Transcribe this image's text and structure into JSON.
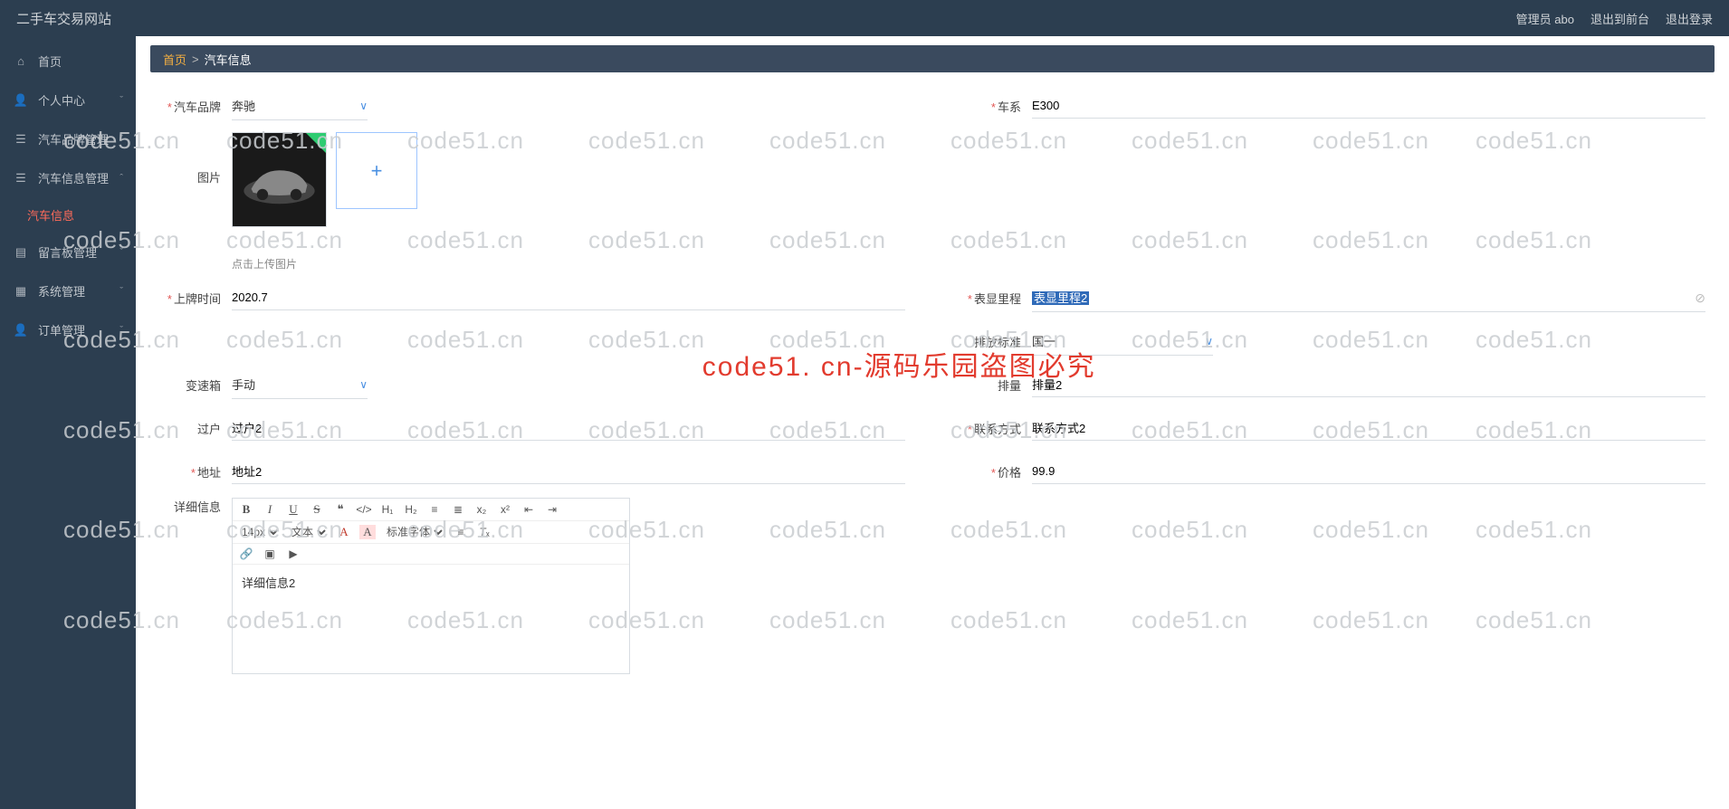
{
  "topbar": {
    "brand": "二手车交易网站",
    "user_label": "管理员 abo",
    "back_front": "退出到前台",
    "logout": "退出登录"
  },
  "sidebar": {
    "items": [
      {
        "icon": "home",
        "label": "首页",
        "chev": ""
      },
      {
        "icon": "user",
        "label": "个人中心",
        "chev": "›"
      },
      {
        "icon": "list",
        "label": "汽车品牌管理",
        "chev": "›"
      },
      {
        "icon": "list",
        "label": "汽车信息管理",
        "chev": "ˆ",
        "open": true,
        "sub": [
          {
            "label": "汽车信息"
          }
        ]
      },
      {
        "icon": "note",
        "label": "留言板管理",
        "chev": "›"
      },
      {
        "icon": "grid",
        "label": "系统管理",
        "chev": "›"
      },
      {
        "icon": "user",
        "label": "订单管理",
        "chev": "›"
      }
    ]
  },
  "breadcrumb": {
    "home": "首页",
    "sep": ">",
    "current": "汽车信息"
  },
  "form": {
    "brand": {
      "label": "汽车品牌",
      "value": "奔驰",
      "required": true
    },
    "series": {
      "label": "车系",
      "value": "E300",
      "required": true
    },
    "image": {
      "label": "图片",
      "hint": "点击上传图片"
    },
    "reg_time": {
      "label": "上牌时间",
      "value": "2020.7",
      "required": true
    },
    "mileage": {
      "label": "表显里程",
      "value": "表显里程2",
      "required": true
    },
    "emission_std": {
      "label": "排放标准",
      "value": "国一",
      "required": false
    },
    "gearbox": {
      "label": "变速箱",
      "value": "手动",
      "required": false
    },
    "displacement": {
      "label": "排量",
      "value": "排量2",
      "required": false
    },
    "transfer": {
      "label": "过户",
      "value": "过户2",
      "required": false
    },
    "contact": {
      "label": "联系方式",
      "value": "联系方式2",
      "required": true
    },
    "address": {
      "label": "地址",
      "value": "地址2",
      "required": true
    },
    "price": {
      "label": "价格",
      "value": "99.9",
      "required": true
    },
    "detail": {
      "label": "详细信息",
      "value": "详细信息2"
    }
  },
  "editor_toolbar": {
    "fontsize": "14px",
    "fonttype": "文本",
    "fontfamily": "标准字体"
  },
  "watermark": {
    "text": "code51.cn",
    "banner": "code51. cn-源码乐园盗图必究"
  }
}
